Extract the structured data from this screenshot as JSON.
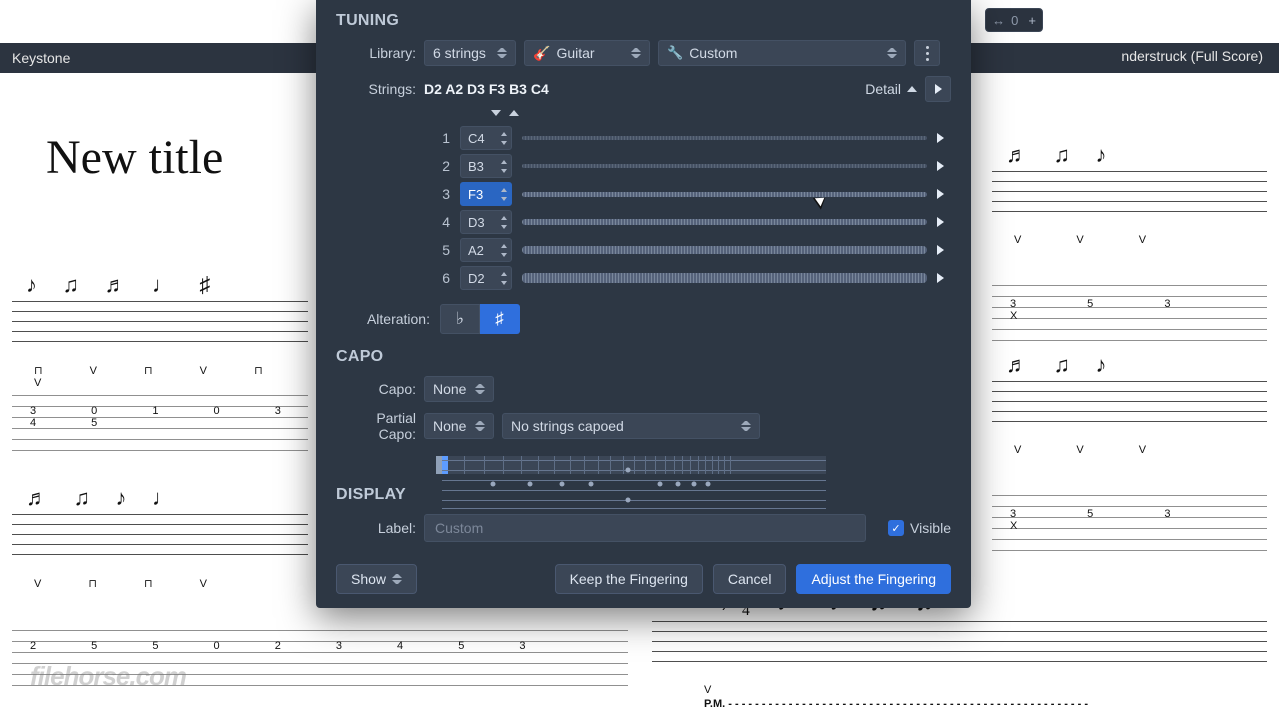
{
  "background": {
    "tab_left": "Keystone",
    "tab_right": "nderstruck (Full Score)",
    "page_title": "New title",
    "watermark": "filehorse.com",
    "zoom_chip": "0"
  },
  "tuning": {
    "heading": "TUNING",
    "library_label": "Library:",
    "library_strings": "6 strings",
    "library_instrument": "Guitar",
    "library_preset": "Custom",
    "strings_label": "Strings:",
    "strings_value": "D2 A2 D3 F3 B3 C4",
    "detail": "Detail",
    "strings": [
      {
        "num": "1",
        "note": "C4"
      },
      {
        "num": "2",
        "note": "B3"
      },
      {
        "num": "3",
        "note": "F3"
      },
      {
        "num": "4",
        "note": "D3"
      },
      {
        "num": "5",
        "note": "A2"
      },
      {
        "num": "6",
        "note": "D2"
      }
    ],
    "alteration_label": "Alteration:",
    "flat": "♭",
    "sharp": "♯"
  },
  "capo": {
    "heading": "CAPO",
    "capo_label": "Capo:",
    "capo_value": "None",
    "partial_label": "Partial Capo:",
    "partial_value": "None",
    "partial_strings": "No strings capoed"
  },
  "display": {
    "heading": "DISPLAY",
    "label_label": "Label:",
    "label_placeholder": "Custom",
    "visible_label": "Visible"
  },
  "footer": {
    "show": "Show",
    "keep": "Keep the Fingering",
    "cancel": "Cancel",
    "adjust": "Adjust the Fingering"
  }
}
